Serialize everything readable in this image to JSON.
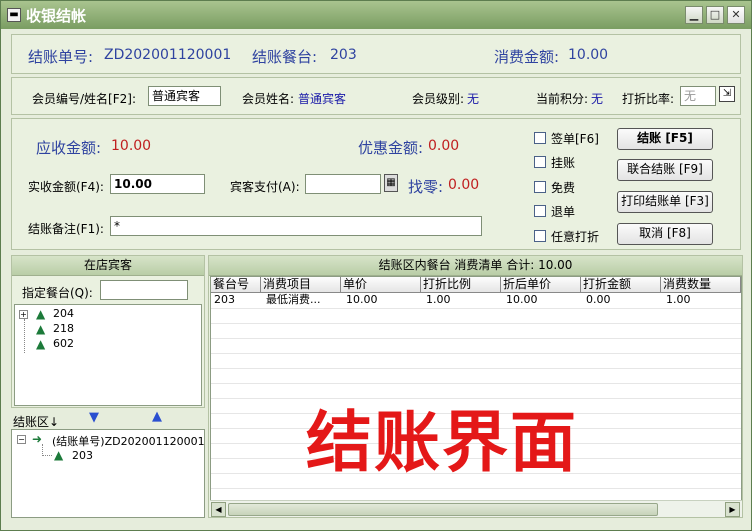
{
  "window": {
    "title": "收银结帐",
    "sys_icon": "▬",
    "min": "▁",
    "max": "□",
    "close": "✕"
  },
  "summary": {
    "bill_no_label": "结账单号:",
    "bill_no": "ZD202001120001",
    "table_label": "结账餐台:",
    "table": "203",
    "consume_label": "消费金额:",
    "consume": "10.00"
  },
  "member": {
    "id_label": "会员编号/姓名[F2]:",
    "id_value": "普通宾客",
    "name_label": "会员姓名:",
    "name": "普通宾客",
    "level_label": "会员级别:",
    "level": "无",
    "points_label": "当前积分:",
    "points": "无",
    "discount_label": "打折比率:",
    "discount_placeholder": "无"
  },
  "payment": {
    "receivable_label": "应收金额:",
    "receivable": "10.00",
    "discount_amount_label": "优惠金额:",
    "discount_amount": "0.00",
    "actual_label": "实收金额(F4):",
    "actual": "10.00",
    "guest_pay_label": "宾客支付(A):",
    "guest_pay": "",
    "change_label": "找零:",
    "change": "0.00",
    "remark_label": "结账备注(F1):",
    "remark": "*"
  },
  "options": [
    "签单[F6]",
    "挂账",
    "免费",
    "退单",
    "任意打折"
  ],
  "buttons": {
    "checkout": "结账 [F5]",
    "combined": "联合结账 [F9]",
    "print": "打印结账单 [F3]",
    "cancel": "取消 [F8]"
  },
  "guests": {
    "header": "在店宾客",
    "filter_label": "指定餐台(Q):",
    "tables": [
      "204",
      "218",
      "602"
    ]
  },
  "checkout_area": {
    "label": "结账区↓",
    "bill_node": "(结账单号)ZD202001120001",
    "table_node": "203"
  },
  "grid": {
    "header": "结账区内餐台  消费清单  合计: 10.00",
    "columns": [
      "餐台号",
      "消费项目",
      "单价",
      "打折比例",
      "折后单价",
      "打折金额",
      "消费数量"
    ],
    "rows": [
      [
        "203",
        "最低消费...",
        "10.00",
        "1.00",
        "10.00",
        "0.00",
        "1.00"
      ]
    ]
  },
  "watermark": "结账界面",
  "colors": {
    "label_blue": "#2f43a0",
    "value_red": "#c02020",
    "title_bar": "#7a9d62",
    "watermark": "#e41818"
  }
}
